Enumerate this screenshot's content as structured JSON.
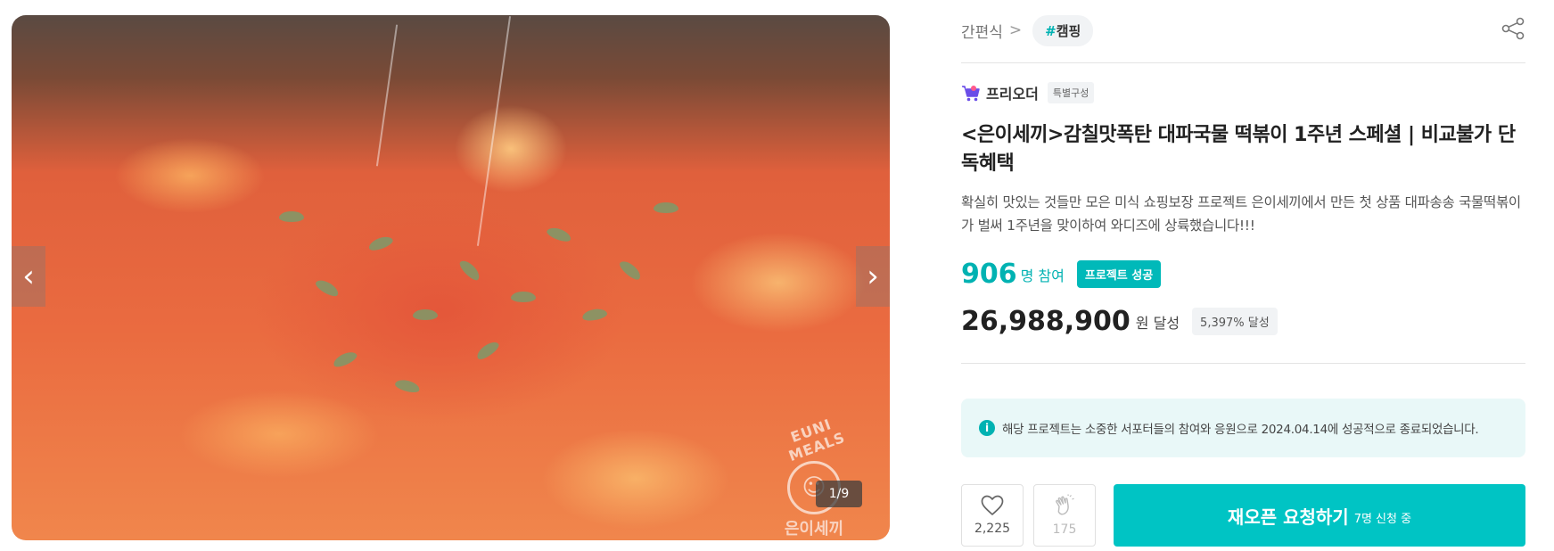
{
  "gallery": {
    "counter": "1/9",
    "watermark_top": "EUNI MEALS",
    "watermark_bottom": "은이세끼",
    "prev_icon": "chevron-left-icon",
    "next_icon": "chevron-right-icon"
  },
  "breadcrumb": {
    "category": "간편식",
    "tag": "캠핑",
    "tag_hash": "#"
  },
  "maker": {
    "name": "프리오더",
    "badge": "특별구성"
  },
  "product": {
    "title": "<은이세끼>감칠맛폭탄 대파국물 떡볶이 1주년 스페셜 | 비교불가 단독혜택",
    "summary": "확실히 맛있는 것들만 모은 미식 쇼핑보장 프로젝트 은이세끼에서 만든 첫 상품 대파송송 국물떡볶이가 벌써 1주년을 맞이하여 와디즈에 상륙했습니다!!!"
  },
  "stats": {
    "supporters": "906",
    "supporters_unit": "명 참여",
    "status_badge": "프로젝트 성공",
    "amount": "26,988,900",
    "amount_unit": "원 달성",
    "rate": "5,397% 달성"
  },
  "notice": {
    "icon": "i",
    "text": "해당 프로젝트는 소중한 서포터들의 참여와 응원으로 2024.04.14에 성공적으로 종료되었습니다."
  },
  "actions": {
    "like_count": "2,225",
    "cheer_count": "175",
    "reopen_label": "재오픈 요청하기",
    "reopen_sub": "7명 신청 중"
  },
  "colors": {
    "accent": "#00b2b2",
    "button": "#00c4c4",
    "notice_bg": "#e9f8f8"
  }
}
